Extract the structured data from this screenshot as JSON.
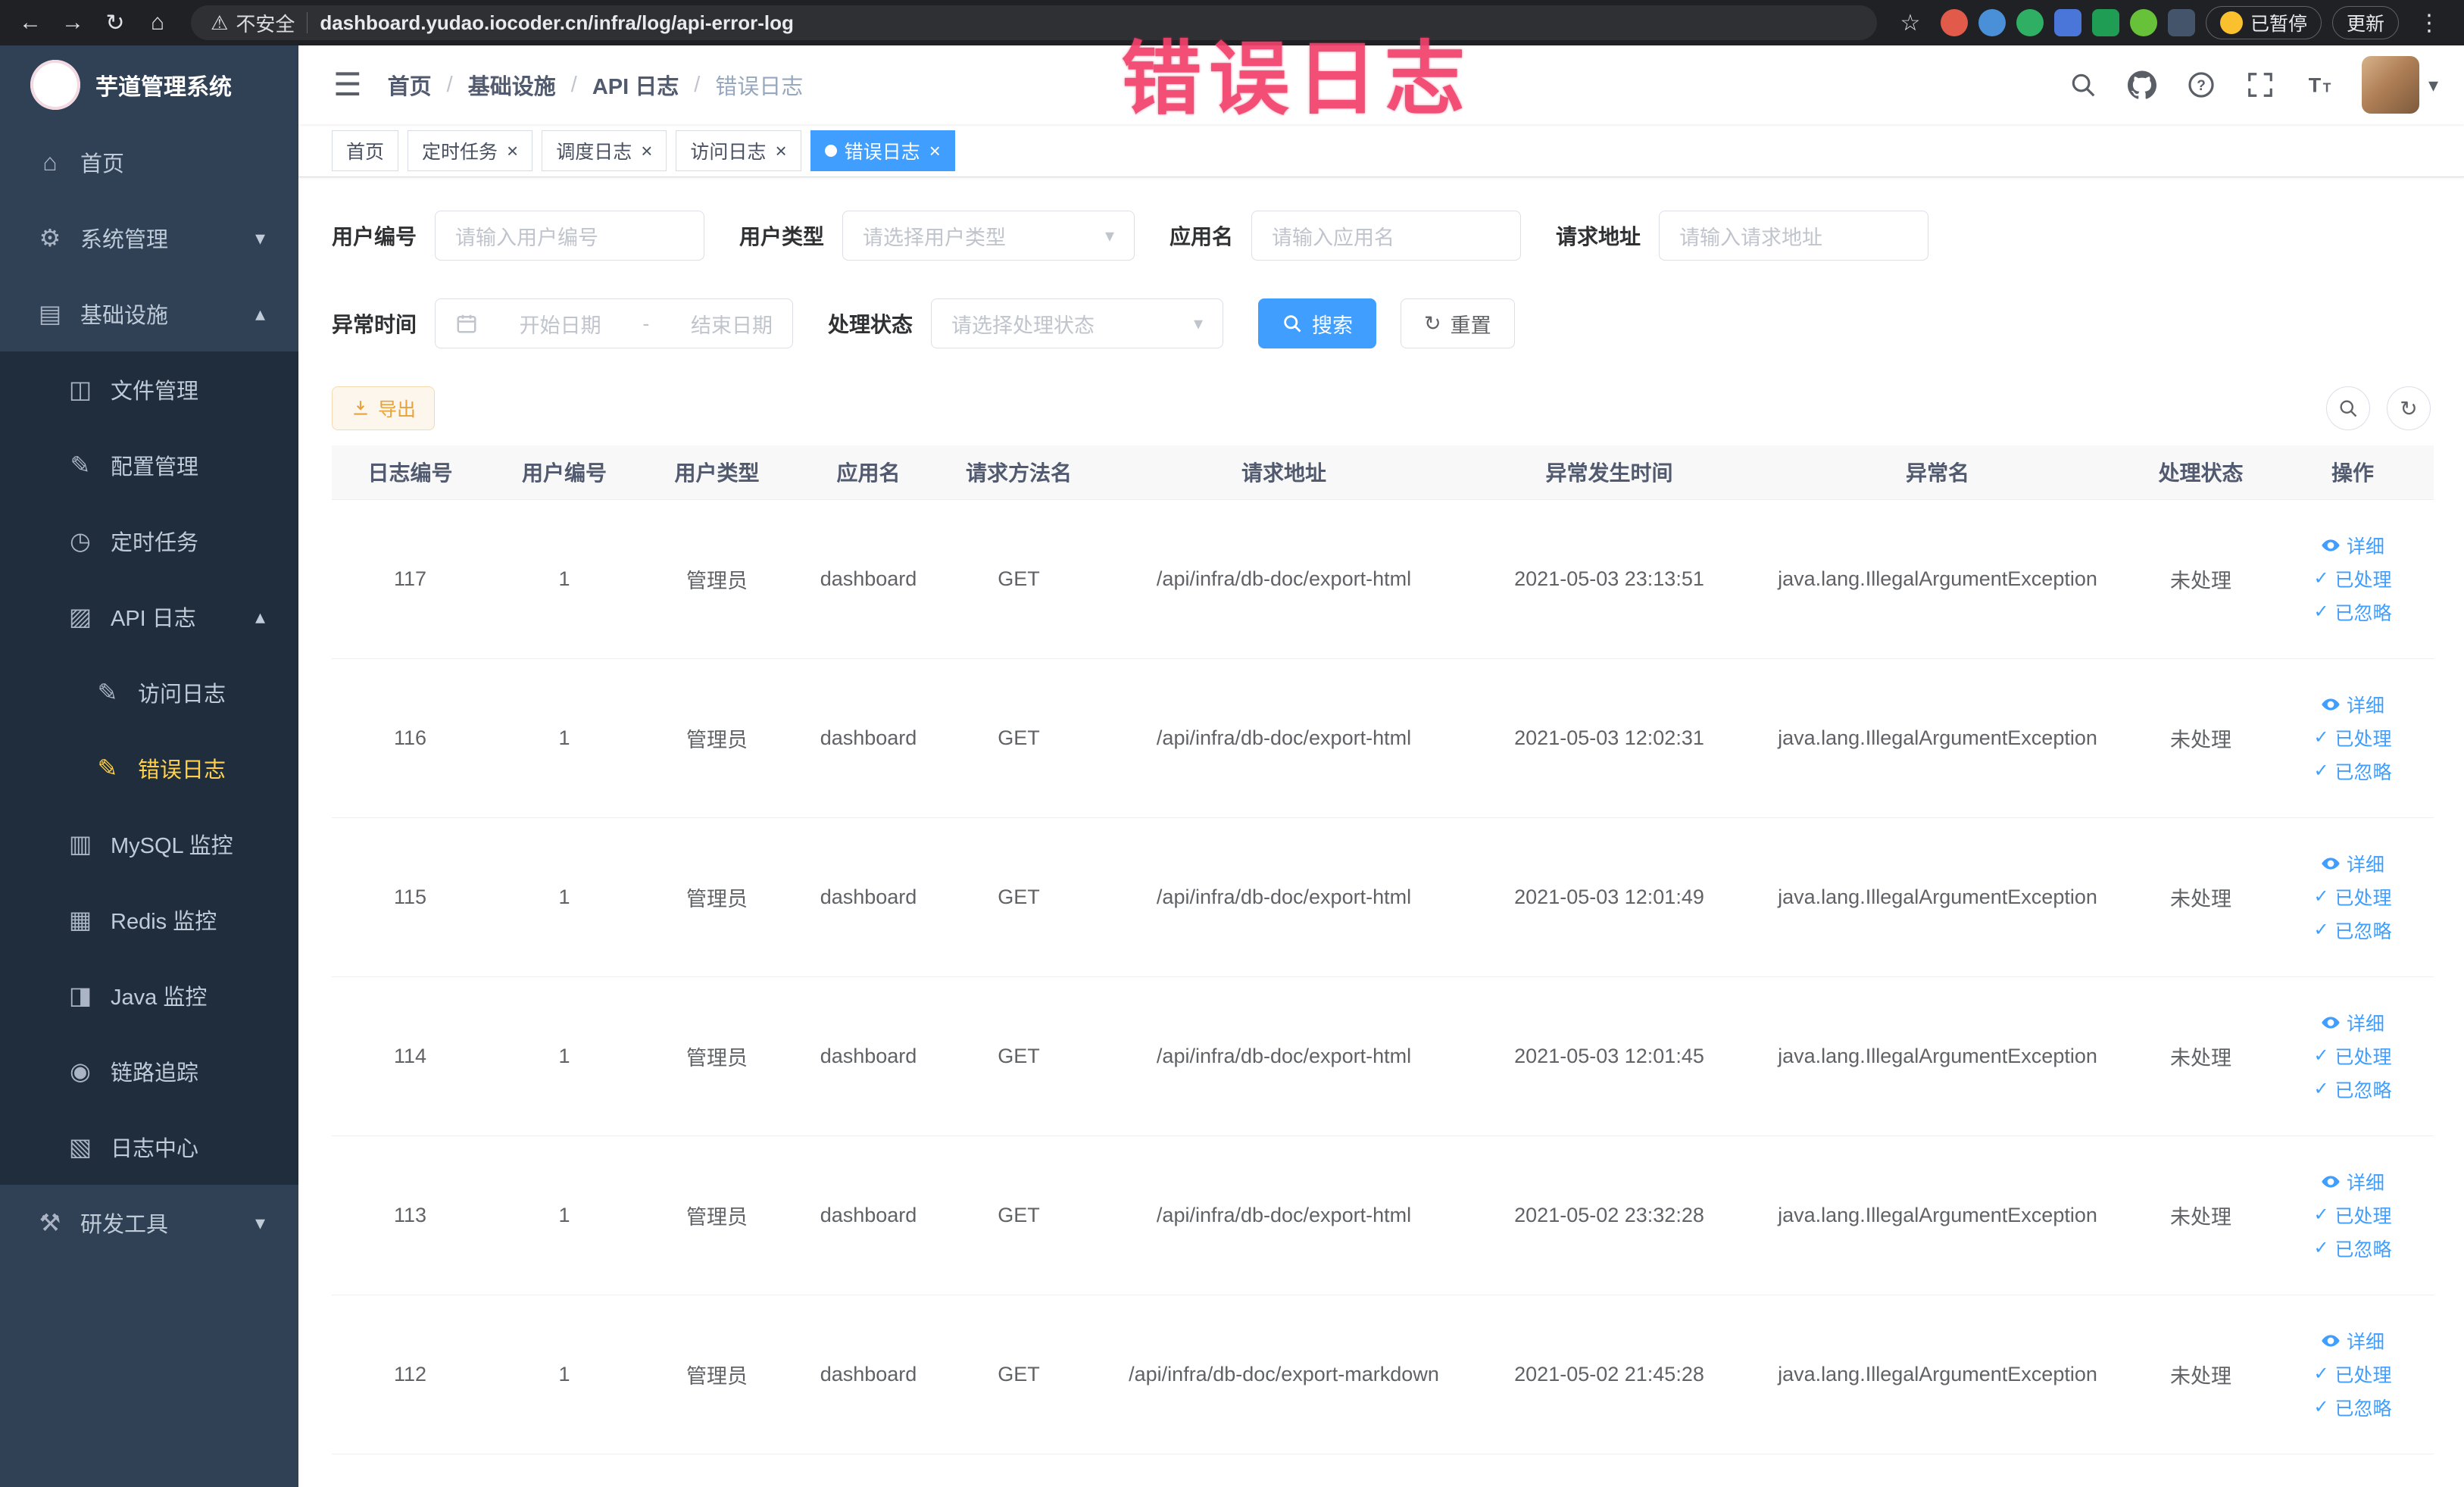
{
  "browser": {
    "security_label": "不安全",
    "url": "dashboard.yudao.iocoder.cn/infra/log/api-error-log",
    "paused_badge": "已暂停",
    "update_label": "更新"
  },
  "annotation": "错误日志",
  "sidebar": {
    "title": "芋道管理系统",
    "items": [
      {
        "label": "首页",
        "icon": "home-icon",
        "level": 1
      },
      {
        "label": "系统管理",
        "icon": "gear-icon",
        "level": 1,
        "chevron": "down"
      },
      {
        "label": "基础设施",
        "icon": "infrastructure-icon",
        "level": 1,
        "chevron": "up"
      },
      {
        "label": "文件管理",
        "icon": "file-manage-icon",
        "level": 2
      },
      {
        "label": "配置管理",
        "icon": "config-manage-icon",
        "level": 2
      },
      {
        "label": "定时任务",
        "icon": "scheduled-task-icon",
        "level": 2
      },
      {
        "label": "API 日志",
        "icon": "api-log-icon",
        "level": 2,
        "chevron": "up"
      },
      {
        "label": "访问日志",
        "icon": "access-log-icon",
        "level": 3
      },
      {
        "label": "错误日志",
        "icon": "error-log-icon",
        "level": 3,
        "active": true
      },
      {
        "label": "MySQL 监控",
        "icon": "mysql-monitor-icon",
        "level": 2
      },
      {
        "label": "Redis 监控",
        "icon": "redis-monitor-icon",
        "level": 2
      },
      {
        "label": "Java 监控",
        "icon": "java-monitor-icon",
        "level": 2
      },
      {
        "label": "链路追踪",
        "icon": "trace-icon",
        "level": 2
      },
      {
        "label": "日志中心",
        "icon": "log-center-icon",
        "level": 2
      },
      {
        "label": "研发工具",
        "icon": "dev-tools-icon",
        "level": 1,
        "chevron": "down"
      }
    ]
  },
  "breadcrumb": [
    "首页",
    "基础设施",
    "API 日志",
    "错误日志"
  ],
  "tags": [
    {
      "label": "首页",
      "closable": false,
      "active": false
    },
    {
      "label": "定时任务",
      "closable": true,
      "active": false
    },
    {
      "label": "调度日志",
      "closable": true,
      "active": false
    },
    {
      "label": "访问日志",
      "closable": true,
      "active": false
    },
    {
      "label": "错误日志",
      "closable": true,
      "active": true
    }
  ],
  "filters": {
    "user_id_label": "用户编号",
    "user_id_placeholder": "请输入用户编号",
    "user_type_label": "用户类型",
    "user_type_placeholder": "请选择用户类型",
    "app_name_label": "应用名",
    "app_name_placeholder": "请输入应用名",
    "request_url_label": "请求地址",
    "request_url_placeholder": "请输入请求地址",
    "exception_time_label": "异常时间",
    "date_start_placeholder": "开始日期",
    "date_separator": "-",
    "date_end_placeholder": "结束日期",
    "process_status_label": "处理状态",
    "process_status_placeholder": "请选择处理状态",
    "search_label": "搜索",
    "reset_label": "重置"
  },
  "toolbar": {
    "export_label": "导出"
  },
  "table": {
    "headers": [
      "日志编号",
      "用户编号",
      "用户类型",
      "应用名",
      "请求方法名",
      "请求地址",
      "异常发生时间",
      "异常名",
      "处理状态",
      "操作"
    ],
    "actions": [
      {
        "label": "详细",
        "icon": "eye-icon"
      },
      {
        "label": "已处理",
        "icon": "check-icon"
      },
      {
        "label": "已忽略",
        "icon": "check-icon"
      }
    ],
    "rows": [
      {
        "cells": [
          "117",
          "1",
          "管理员",
          "dashboard",
          "GET",
          "/api/infra/db-doc/export-html",
          "2021-05-03 23:13:51",
          "java.lang.IllegalArgumentException",
          "未处理"
        ]
      },
      {
        "cells": [
          "116",
          "1",
          "管理员",
          "dashboard",
          "GET",
          "/api/infra/db-doc/export-html",
          "2021-05-03 12:02:31",
          "java.lang.IllegalArgumentException",
          "未处理"
        ]
      },
      {
        "cells": [
          "115",
          "1",
          "管理员",
          "dashboard",
          "GET",
          "/api/infra/db-doc/export-html",
          "2021-05-03 12:01:49",
          "java.lang.IllegalArgumentException",
          "未处理"
        ]
      },
      {
        "cells": [
          "114",
          "1",
          "管理员",
          "dashboard",
          "GET",
          "/api/infra/db-doc/export-html",
          "2021-05-03 12:01:45",
          "java.lang.IllegalArgumentException",
          "未处理"
        ]
      },
      {
        "cells": [
          "113",
          "1",
          "管理员",
          "dashboard",
          "GET",
          "/api/infra/db-doc/export-html",
          "2021-05-02 23:32:28",
          "java.lang.IllegalArgumentException",
          "未处理"
        ]
      },
      {
        "cells": [
          "112",
          "1",
          "管理员",
          "dashboard",
          "GET",
          "/api/infra/db-doc/export-markdown",
          "2021-05-02 21:45:28",
          "java.lang.IllegalArgumentException",
          "未处理"
        ]
      }
    ]
  },
  "colors": {
    "primary": "#409eff",
    "sidebar_bg": "#304156",
    "submenu_bg": "#1f2d3d",
    "menu_active_text": "#ffd04b",
    "warning": "#e6a23c",
    "annotation": "#f2406b"
  }
}
